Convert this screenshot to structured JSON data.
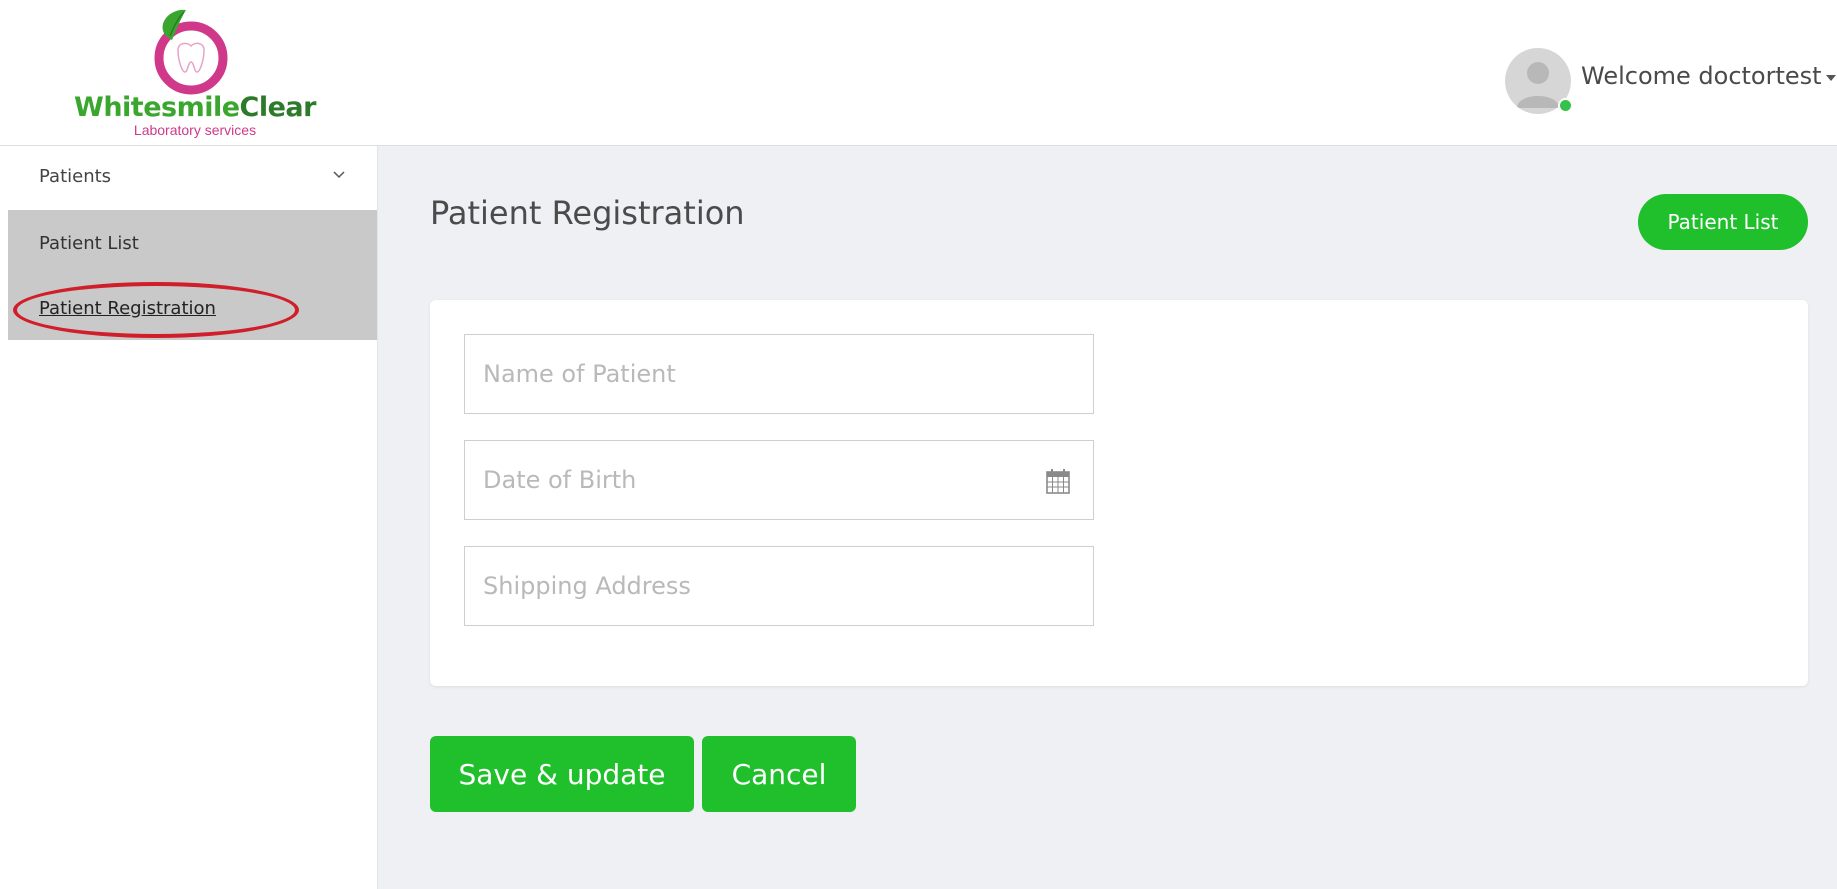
{
  "header": {
    "logo": {
      "title_part1": "Whitesmile",
      "title_part2": "Clear",
      "subtitle": "Laboratory services",
      "icon": "apple-leaf-tooth-logo"
    },
    "user": {
      "welcome_text": "Welcome doctortest",
      "avatar_icon": "user-avatar-icon",
      "status": "online",
      "dropdown_icon": "caret-down-icon"
    }
  },
  "sidebar": {
    "group_label": "Patients",
    "group_icon": "chevron-down-icon",
    "items": [
      {
        "label": "Patient List"
      },
      {
        "label": "Patient Registration",
        "active": true
      }
    ]
  },
  "main": {
    "title": "Patient Registration",
    "patient_list_button": "Patient List",
    "form": {
      "name_placeholder": "Name of Patient",
      "name_value": "",
      "dob_placeholder": "Date of Birth",
      "dob_value": "",
      "dob_icon": "calendar-icon",
      "address_placeholder": "Shipping Address",
      "address_value": ""
    },
    "save_button": "Save & update",
    "cancel_button": "Cancel"
  },
  "colors": {
    "accent_green": "#20c02c",
    "logo_green": "#3aa62e",
    "logo_pink": "#d0398a",
    "sidebar_active_bg": "#c9c9c9",
    "main_bg": "#eef0f3",
    "annotation_red": "#d01f2a"
  }
}
